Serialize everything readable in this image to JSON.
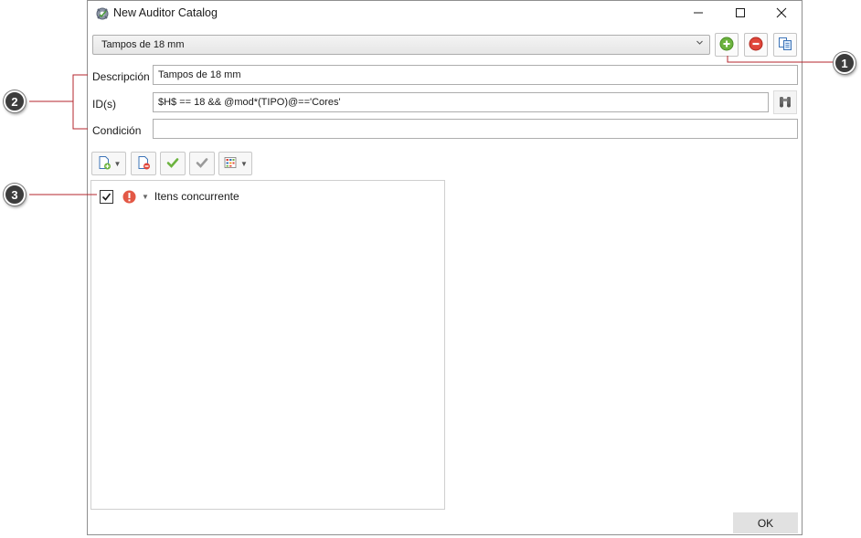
{
  "window": {
    "title": "New Auditor Catalog",
    "app_icon": "auditor-gear-icon",
    "controls": [
      "minimize-icon",
      "maximize-icon",
      "close-icon"
    ]
  },
  "catalog_select": {
    "selected": "Tampos de 18 mm",
    "add_icon": "add-icon",
    "remove_icon": "remove-icon",
    "duplicate_icon": "copy-icon"
  },
  "form": {
    "description_label": "Descripción",
    "description_value": "Tampos de 18 mm",
    "ids_label": "ID(s)",
    "ids_value": "$H$ == 18 && @mod*(TIPO)@=='Cores'",
    "search_icon": "binoculars-icon",
    "condition_label": "Condición",
    "condition_value": ""
  },
  "toolbar": {
    "buttons": [
      "new-rule-icon",
      "delete-rule-icon",
      "check-all-icon",
      "uncheck-all-icon",
      "grid-options-icon"
    ]
  },
  "tree": {
    "items": [
      {
        "label": "Itens concurrente",
        "checked": true,
        "severity_icon": "error-icon"
      }
    ]
  },
  "footer": {
    "ok_label": "OK"
  },
  "callouts": [
    "1",
    "2",
    "3"
  ],
  "colors": {
    "add_green": "#6cb33f",
    "remove_red": "#e0463a",
    "error_red": "#e35846",
    "callout_line": "#b4262d",
    "callout_bg": "#3c3c3c"
  }
}
